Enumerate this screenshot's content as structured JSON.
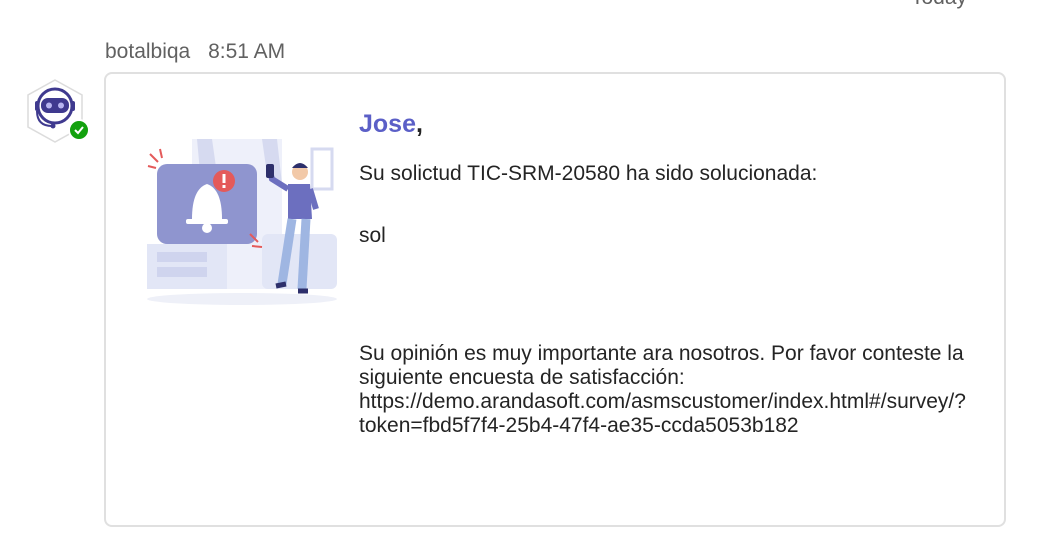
{
  "divider": {
    "label": "Today"
  },
  "message": {
    "sender": "botalbiqa",
    "time": "8:51 AM",
    "avatar_icon": "robot-icon",
    "status": "available",
    "status_color": "#13a10e",
    "card": {
      "greeting_name": "Jose",
      "greeting_punct": ",",
      "line1": "Su solictud TIC-SRM-20580 ha sido solucionada:",
      "line2": "sol",
      "survey_text": "Su opinión es muy importante ara nosotros. Por favor conteste la siguiente encuesta de satisfacción:",
      "survey_url": "https://demo.arandasoft.com/asmscustomer/index.html#/survey/?token=fbd5f7f4-25b4-47f4-ae35-ccda5053b182",
      "illustration": "notification-bell-illustration",
      "accent_color": "#5b5fc7"
    }
  }
}
